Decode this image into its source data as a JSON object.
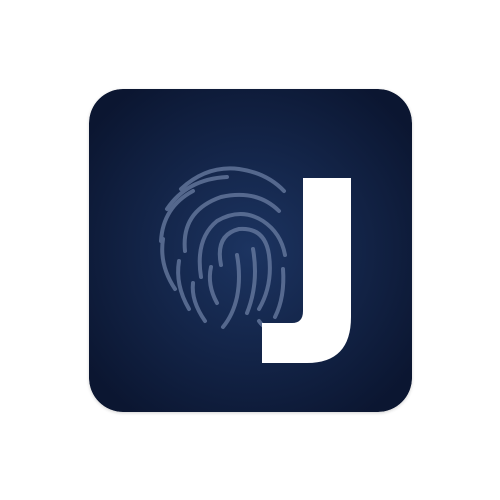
{
  "app_icon": {
    "letter": "J",
    "icons": {
      "background": "rounded-square",
      "emblem": "fingerprint-icon",
      "letter_mark": "letter-j-icon"
    },
    "colors": {
      "page_background": "#ffffff",
      "tile_center": "#1c3461",
      "tile_edge": "#0b1631",
      "fingerprint_stroke": "#6b7ea3",
      "letter_fill": "#ffffff"
    }
  }
}
